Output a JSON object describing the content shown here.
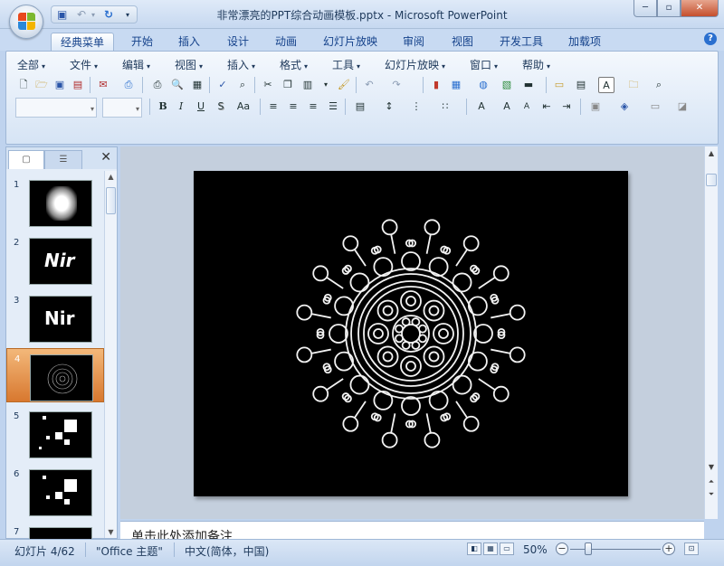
{
  "window": {
    "title": "非常漂亮的PPT综合动画模板.pptx - Microsoft PowerPoint",
    "minimize_label": "─",
    "restore_label": "▫",
    "close_label": "✕"
  },
  "qat": {
    "save_icon": "save-icon",
    "undo_glyph": "↶",
    "redo_glyph": "↷",
    "more_glyph": "▾"
  },
  "tabs": [
    {
      "label": "经典菜单",
      "active": true
    },
    {
      "label": "开始"
    },
    {
      "label": "插入"
    },
    {
      "label": "设计"
    },
    {
      "label": "动画"
    },
    {
      "label": "幻灯片放映"
    },
    {
      "label": "审阅"
    },
    {
      "label": "视图"
    },
    {
      "label": "开发工具"
    },
    {
      "label": "加载项"
    }
  ],
  "help_label": "?",
  "menu": [
    {
      "label": "全部"
    },
    {
      "label": "文件"
    },
    {
      "label": "编辑"
    },
    {
      "label": "视图"
    },
    {
      "label": "插入"
    },
    {
      "label": "格式"
    },
    {
      "label": "工具"
    },
    {
      "label": "幻灯片放映"
    },
    {
      "label": "窗口"
    },
    {
      "label": "帮助"
    }
  ],
  "format_buttons": {
    "bold": "B",
    "italic": "I",
    "underline": "U",
    "shadow": "S",
    "change_case": "Aa",
    "font_color": "A"
  },
  "slides_panel": {
    "thumbnails": [
      {
        "number": "1",
        "kind": "blur"
      },
      {
        "number": "2",
        "kind": "text",
        "text": "Nir"
      },
      {
        "number": "3",
        "kind": "text",
        "text": "Nir"
      },
      {
        "number": "4",
        "kind": "mandala",
        "selected": true
      },
      {
        "number": "5",
        "kind": "squares"
      },
      {
        "number": "6",
        "kind": "squares"
      },
      {
        "number": "7",
        "kind": "blank"
      }
    ],
    "close_label": "✕"
  },
  "notes": {
    "placeholder": "单击此处添加备注"
  },
  "status": {
    "slide_info": "幻灯片 4/62",
    "theme": "\"Office 主题\"",
    "language": "中文(简体，中国)",
    "zoom": "50%",
    "zoom_fraction": 0.2
  },
  "colors": {
    "accent_selected": "#d8782f",
    "ribbon_bg": "#e2ecf8",
    "slide_bg": "#000000"
  }
}
